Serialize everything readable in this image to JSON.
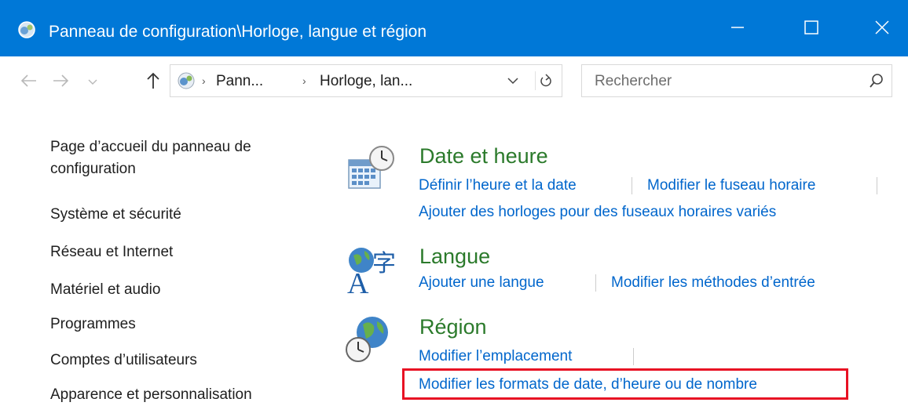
{
  "window": {
    "title": "Panneau de configuration\\Horloge, langue et région",
    "accent_color": "#0078d7",
    "controls": [
      "minimize-icon",
      "maximize-icon",
      "close-icon"
    ]
  },
  "address_bar": {
    "icons": [
      "back-arrow-icon",
      "forward-arrow-icon",
      "chevron-down-icon",
      "up-arrow-icon",
      "control-panel-icon",
      "refresh-icon"
    ],
    "breadcrumbs": [
      "Pann...",
      "Horloge, lan..."
    ],
    "search_placeholder": "Rechercher"
  },
  "sidebar": {
    "items": [
      "Page d’accueil du panneau de",
      "configuration",
      "Système et sécurité",
      "Réseau et Internet",
      "Matériel et audio",
      "Programmes",
      "Comptes d’utilisateurs",
      "Apparence et personnalisation"
    ]
  },
  "categories": [
    {
      "title": "Date et heure",
      "icon": "calendar-clock-icon",
      "links": [
        "Définir l’heure et la date",
        "Modifier le fuseau horaire",
        "Ajouter des horloges pour des fuseaux horaires variés"
      ]
    },
    {
      "title": "Langue",
      "icon": "language-globe-icon",
      "links": [
        "Ajouter une langue",
        "Modifier les méthodes d’entrée"
      ]
    },
    {
      "title": "Région",
      "icon": "region-globe-clock-icon",
      "links": [
        "Modifier l’emplacement",
        "Modifier les formats de date, d’heure ou de nombre"
      ]
    }
  ],
  "colors": {
    "category_title": "#2b7a2b",
    "link": "#0066cc",
    "highlight": "#e81123"
  }
}
